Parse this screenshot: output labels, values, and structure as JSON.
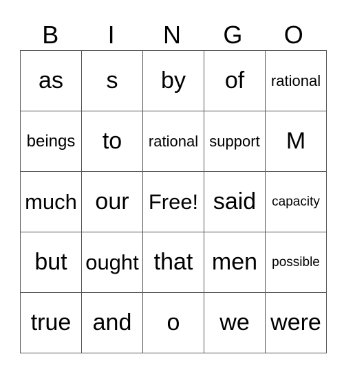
{
  "header": [
    "B",
    "I",
    "N",
    "G",
    "O"
  ],
  "rows": [
    [
      {
        "t": "as",
        "s": "s-xl"
      },
      {
        "t": "s",
        "s": "s-xl"
      },
      {
        "t": "by",
        "s": "s-xl"
      },
      {
        "t": "of",
        "s": "s-xl"
      },
      {
        "t": "rational",
        "s": "s-s"
      }
    ],
    [
      {
        "t": "beings",
        "s": "s-m"
      },
      {
        "t": "to",
        "s": "s-xl"
      },
      {
        "t": "rational",
        "s": "s-s"
      },
      {
        "t": "support",
        "s": "s-s"
      },
      {
        "t": "M",
        "s": "s-xl"
      }
    ],
    [
      {
        "t": "much",
        "s": "s-l"
      },
      {
        "t": "our",
        "s": "s-xl"
      },
      {
        "t": "Free!",
        "s": "s-l"
      },
      {
        "t": "said",
        "s": "s-xl"
      },
      {
        "t": "capacity",
        "s": "s-xs"
      }
    ],
    [
      {
        "t": "but",
        "s": "s-xl"
      },
      {
        "t": "ought",
        "s": "s-l"
      },
      {
        "t": "that",
        "s": "s-xl"
      },
      {
        "t": "men",
        "s": "s-xl"
      },
      {
        "t": "possible",
        "s": "s-xs"
      }
    ],
    [
      {
        "t": "true",
        "s": "s-xl"
      },
      {
        "t": "and",
        "s": "s-xl"
      },
      {
        "t": "o",
        "s": "s-xl"
      },
      {
        "t": "we",
        "s": "s-xl"
      },
      {
        "t": "were",
        "s": "s-xl"
      }
    ]
  ]
}
